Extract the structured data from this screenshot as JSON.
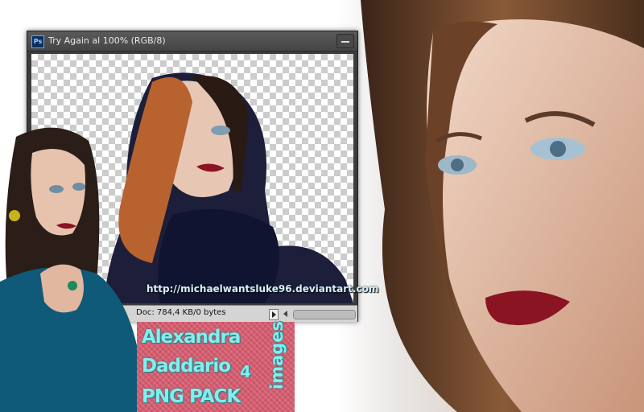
{
  "window": {
    "title": "Try Again al 100% (RGB/8)",
    "app_icon_label": "Ps",
    "status": "Doc: 784,4 KB/0 bytes"
  },
  "watermark": "http://michaelwantsluke96.deviantart.com",
  "banner": {
    "line1": "Alexandra",
    "line2": "Daddario",
    "line3": "PNG PACK",
    "count": "4",
    "images_word": "images"
  },
  "colors": {
    "banner_bg": "#d65c6f",
    "banner_text": "#7ff0ee",
    "ps_chrome": "#3c3c3c"
  },
  "icons": [
    "photoshop-logo-icon",
    "minimize-icon",
    "status-arrow-icon",
    "scroll-left-icon"
  ]
}
